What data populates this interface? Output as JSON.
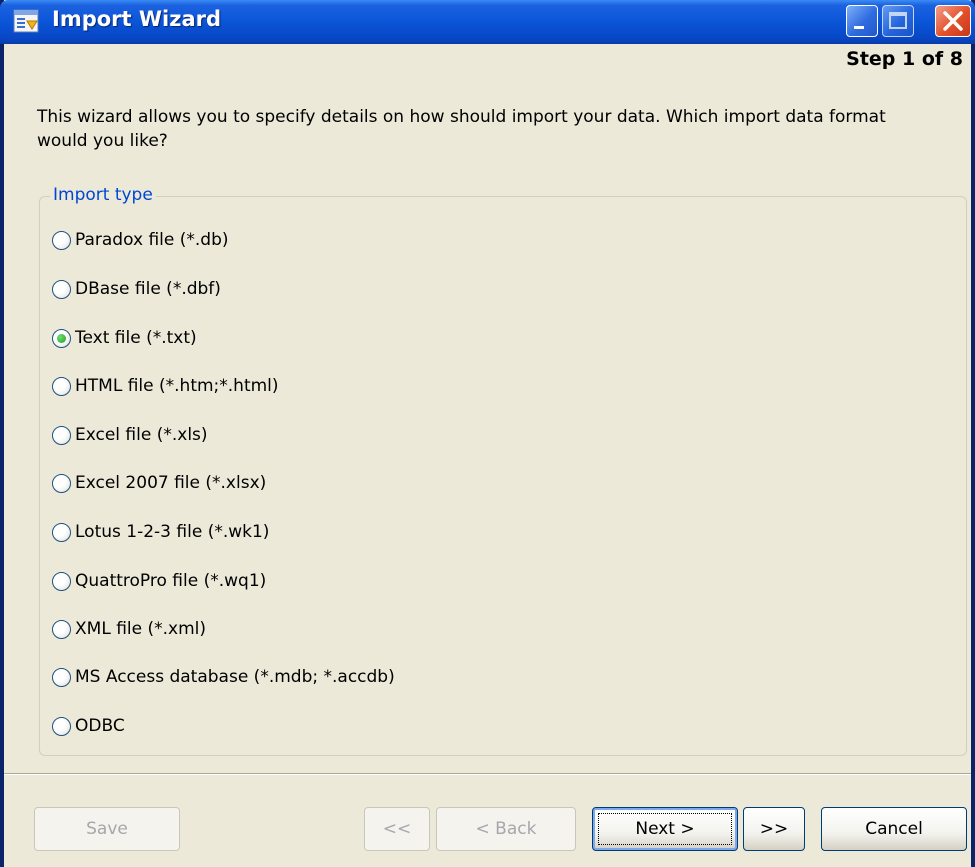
{
  "window": {
    "title": "Import Wizard",
    "step": "Step 1 of 8"
  },
  "intro_text": "This wizard allows you to specify details on how should import your data. Which import data format would you like?",
  "import_type": {
    "label": "Import type",
    "selected": "Text file (*.txt)",
    "options": [
      "Paradox file (*.db)",
      "DBase file (*.dbf)",
      "Text file (*.txt)",
      "HTML file (*.htm;*.html)",
      "Excel file (*.xls)",
      "Excel 2007 file (*.xlsx)",
      "Lotus 1-2-3 file (*.wk1)",
      "QuattroPro file (*.wq1)",
      "XML file (*.xml)",
      "MS Access database (*.mdb; *.accdb)",
      "ODBC"
    ]
  },
  "buttons": {
    "save": "Save",
    "first": "<<",
    "back": "< Back",
    "next": "Next >",
    "last": ">>",
    "cancel": "Cancel"
  },
  "colors": {
    "titlebar": "#0A55D8",
    "group_label": "#0046D5",
    "window_bg": "#ECE9D8"
  }
}
